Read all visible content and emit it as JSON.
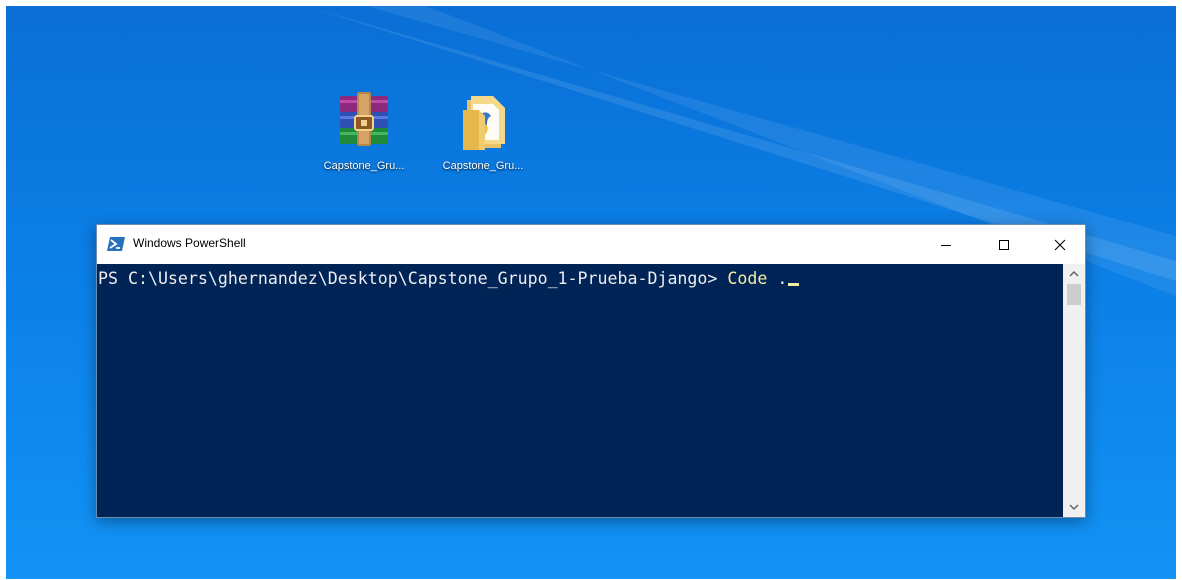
{
  "desktop": {
    "icons": [
      {
        "label": "Capstone_Gru...",
        "icon": "winrar-archive-icon"
      },
      {
        "label": "Capstone_Gru...",
        "icon": "folder-icon"
      }
    ]
  },
  "window": {
    "title": "Windows PowerShell",
    "app_icon": "powershell-icon",
    "controls": {
      "minimize": "minimize-icon",
      "maximize": "maximize-icon",
      "close": "close-icon"
    }
  },
  "terminal": {
    "prompt": "PS C:\\Users\\ghernandez\\Desktop\\Capstone_Grupo_1-Prueba-Django> ",
    "command": "Code",
    "argument": " ."
  },
  "colors": {
    "desktop_blue": "#0b7fe6",
    "console_background": "#012456",
    "console_text": "#eeedf0",
    "command_text": "#f4eca2"
  }
}
